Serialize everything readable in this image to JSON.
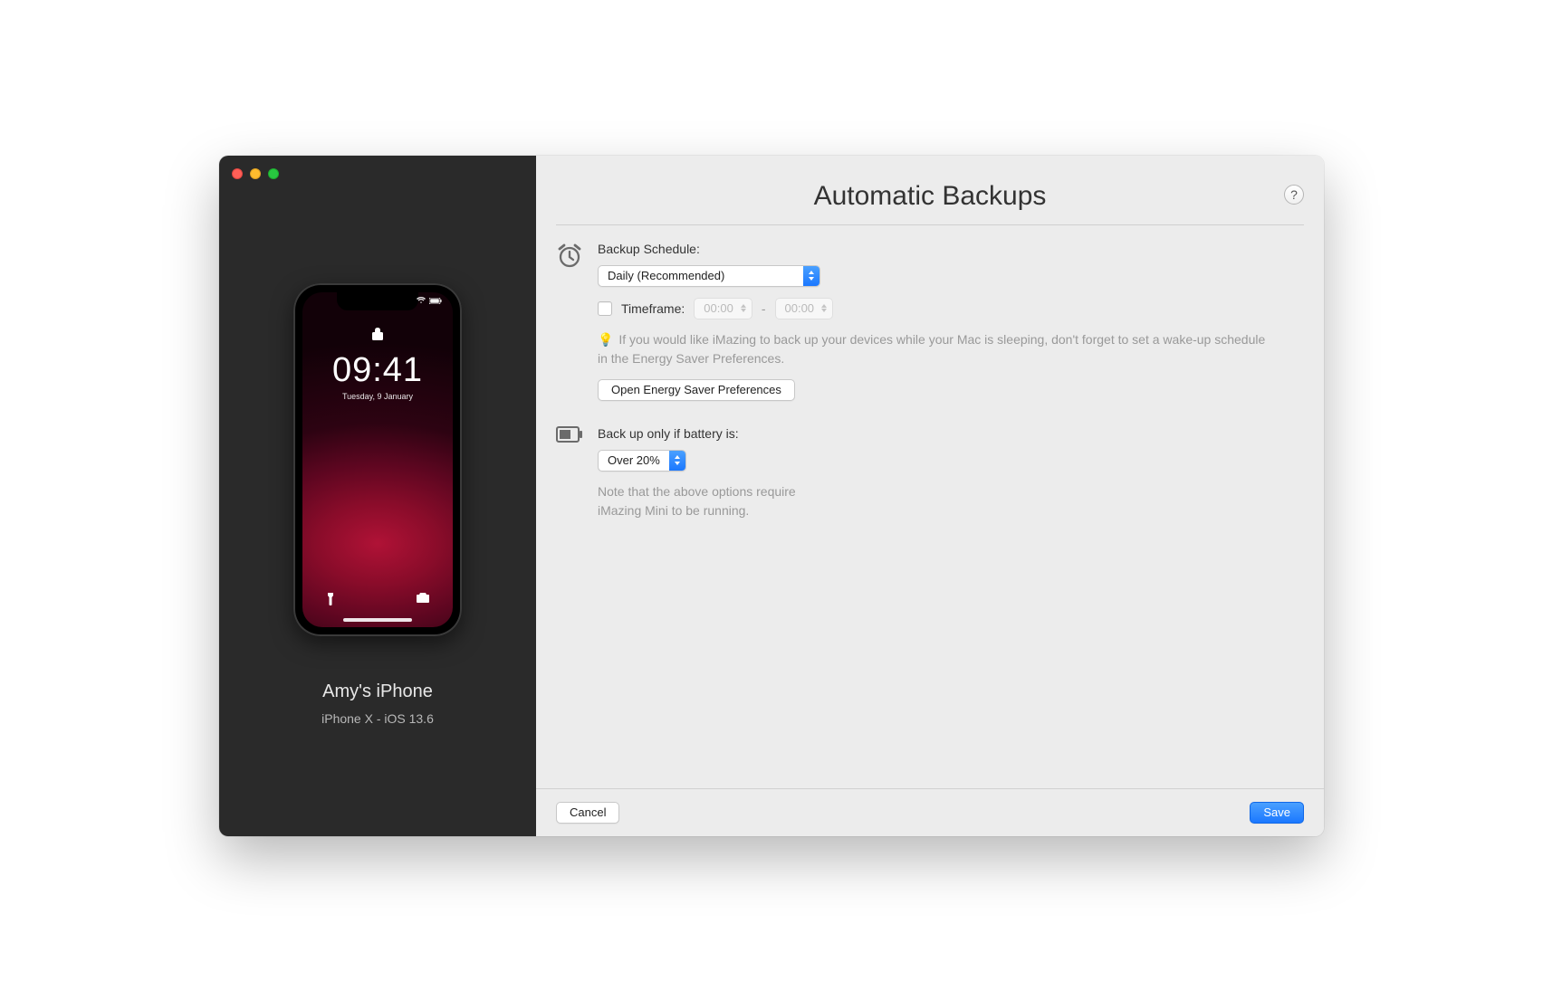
{
  "title": "Automatic Backups",
  "device": {
    "name": "Amy's iPhone",
    "model_line": "iPhone X - iOS 13.6",
    "clock": "09:41",
    "date": "Tuesday, 9 January"
  },
  "schedule": {
    "label": "Backup Schedule:",
    "selected": "Daily (Recommended)",
    "timeframe_label": "Timeframe:",
    "time_from": "00:00",
    "time_to": "00:00",
    "hint_prefix": "💡",
    "hint": " If you would like iMazing to back up your devices while your Mac is sleeping, don't forget to set a wake-up schedule in the Energy Saver Preferences.",
    "energy_button": "Open Energy Saver Preferences"
  },
  "battery": {
    "label": "Back up only if battery is:",
    "selected": "Over 20%",
    "note": "Note that the above options require iMazing Mini to be running."
  },
  "footer": {
    "cancel": "Cancel",
    "save": "Save"
  },
  "help": "?"
}
